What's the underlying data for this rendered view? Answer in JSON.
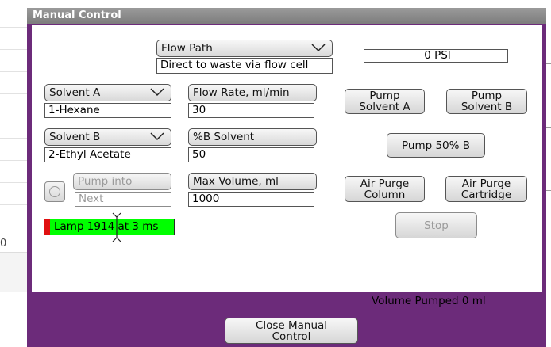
{
  "window": {
    "title": "Manual Control"
  },
  "flow_path": {
    "label": "Flow Path",
    "value": "Direct to waste via flow cell"
  },
  "pressure": {
    "value": "0 PSI"
  },
  "solvent_a": {
    "label": "Solvent A",
    "value": "1-Hexane"
  },
  "solvent_b": {
    "label": "Solvent B",
    "value": "2-Ethyl Acetate"
  },
  "flow_rate": {
    "label": "Flow Rate, ml/min",
    "value": "30"
  },
  "percent_b": {
    "label": "%B Solvent",
    "value": "50"
  },
  "max_volume": {
    "label": "Max Volume, ml",
    "value": "1000"
  },
  "pump_into": {
    "label": "Pump into",
    "value": "Next"
  },
  "buttons": {
    "pump_a_line1": "Pump",
    "pump_a_line2": "Solvent A",
    "pump_b_line1": "Pump",
    "pump_b_line2": "Solvent B",
    "pump_50": "Pump 50% B",
    "air_col_line1": "Air Purge",
    "air_col_line2": "Column",
    "air_cart_line1": "Air Purge",
    "air_cart_line2": "Cartridge",
    "stop": "Stop",
    "close_line1": "Close Manual",
    "close_line2": "Control"
  },
  "lamp": {
    "text": "Lamp 1914 at 3 ms",
    "status_color": "#00ff00",
    "indicator_color": "#e01010"
  },
  "volume_pumped": "Volume Pumped 0 ml",
  "background": {
    "partial_char": "0"
  },
  "colors": {
    "frame": "#6c2b7a",
    "titlebar": "#8a8a8a"
  }
}
